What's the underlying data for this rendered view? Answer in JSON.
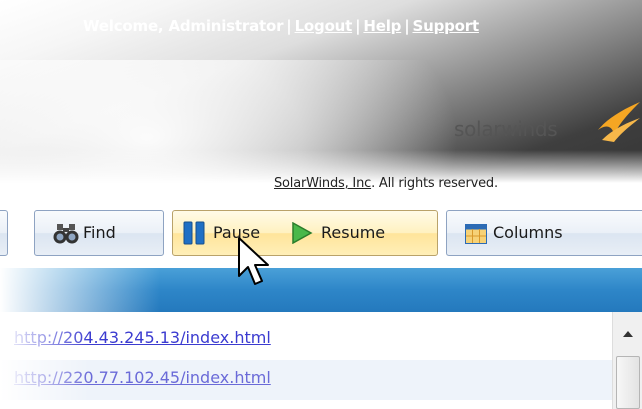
{
  "header": {
    "welcome": "Welcome, Administrator",
    "links": {
      "logout": "Logout",
      "help": "Help",
      "support": "Support"
    },
    "separator": "|",
    "brand": "solarwinds",
    "copyright_company": "SolarWinds, Inc",
    "copyright_rest": ". All rights reserved."
  },
  "toolbar": {
    "find_label": "Find",
    "pause_label": "Pause",
    "resume_label": "Resume",
    "columns_label": "Columns"
  },
  "list": {
    "rows": [
      {
        "url": "http://204.43.245.13/index.html"
      },
      {
        "url": "http://220.77.102.45/index.html"
      }
    ]
  },
  "colors": {
    "accent_blue": "#2e86c8",
    "brand_orange": "#f5a623",
    "link_blue": "#3b3bd0",
    "pause_highlight": "#ffe49a"
  },
  "icons": {
    "find": "binoculars-icon",
    "pause": "pause-icon",
    "resume": "play-icon",
    "columns": "columns-icon",
    "brand": "solarwinds-flame-icon"
  }
}
